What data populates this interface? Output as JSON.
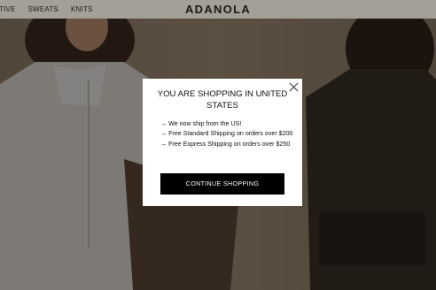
{
  "header": {
    "nav_items": [
      "CTIVE",
      "SWEATS",
      "KNITS"
    ],
    "logo": "ADANOLA"
  },
  "modal": {
    "title": "YOU ARE SHOPPING IN UNITED STATES",
    "bullets": [
      "→ We now ship from the US!",
      "→ Free Standard Shipping on orders over $200",
      "→ Free Express Shipping on orders over $250"
    ],
    "cta_label": "CONTINUE SHOPPING",
    "close_icon": "close-icon"
  },
  "colors": {
    "header_bg": "#a49f97",
    "cta_bg": "#000000",
    "modal_bg": "#ffffff"
  }
}
